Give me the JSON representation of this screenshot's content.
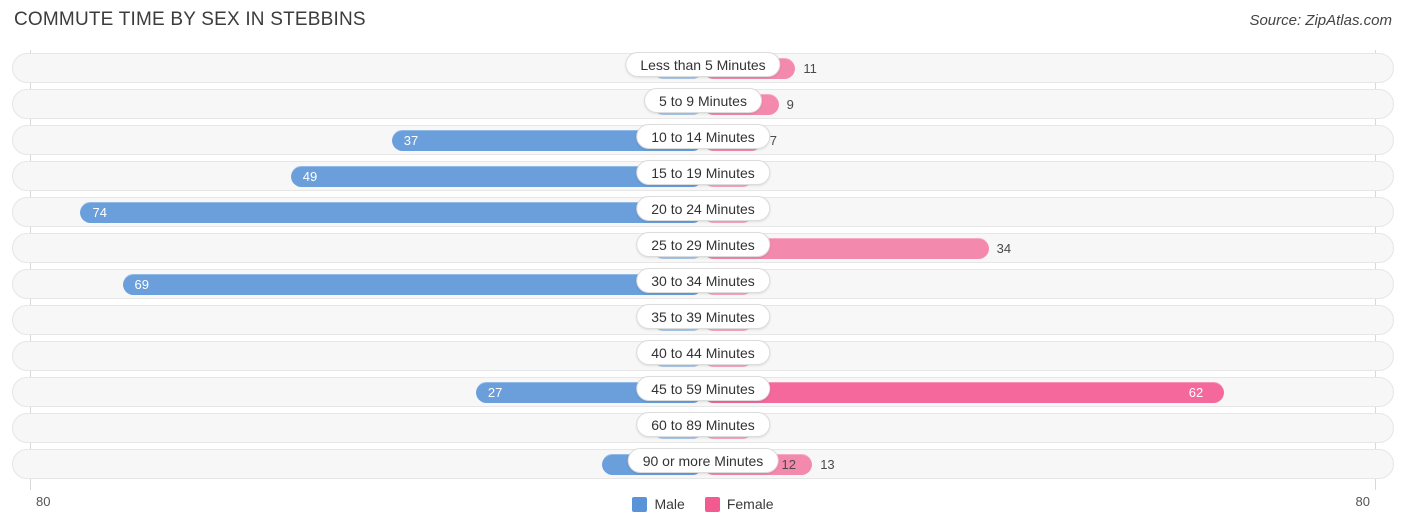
{
  "header": {
    "title": "COMMUTE TIME BY SEX IN STEBBINS",
    "source": "Source: ZipAtlas.com"
  },
  "axis": {
    "left_label": "80",
    "right_label": "80",
    "max": 80
  },
  "legend": {
    "male_label": "Male",
    "female_label": "Female",
    "male_color": "#5b93d8",
    "female_color": "#f25a90"
  },
  "colors": {
    "male": "#6a9fdc",
    "male_light": "#a9c8ea",
    "female": "#f4689c",
    "female_light": "#f9a7c3",
    "female_mid": "#f489ae",
    "track": "#f7f7f7",
    "track_border": "#e6e6e6"
  },
  "chart_data": {
    "type": "bar",
    "title": "COMMUTE TIME BY SEX IN STEBBINS",
    "subtitle": "Source: ZipAtlas.com",
    "orientation": "horizontal-diverging",
    "xlabel": "",
    "ylabel": "",
    "xlim": [
      80,
      80
    ],
    "grid": false,
    "legend_position": "bottom-center",
    "categories": [
      "Less than 5 Minutes",
      "5 to 9 Minutes",
      "10 to 14 Minutes",
      "15 to 19 Minutes",
      "20 to 24 Minutes",
      "25 to 29 Minutes",
      "30 to 34 Minutes",
      "35 to 39 Minutes",
      "40 to 44 Minutes",
      "45 to 59 Minutes",
      "60 to 89 Minutes",
      "90 or more Minutes"
    ],
    "series": [
      {
        "name": "Male",
        "values": [
          0,
          0,
          37,
          49,
          74,
          0,
          69,
          0,
          0,
          27,
          0,
          12
        ]
      },
      {
        "name": "Female",
        "values": [
          11,
          9,
          7,
          0,
          0,
          34,
          0,
          0,
          0,
          62,
          0,
          13
        ]
      }
    ]
  },
  "rows": [
    {
      "label": "Less than 5 Minutes",
      "male": "0",
      "female": "11"
    },
    {
      "label": "5 to 9 Minutes",
      "male": "0",
      "female": "9"
    },
    {
      "label": "10 to 14 Minutes",
      "male": "37",
      "female": "7"
    },
    {
      "label": "15 to 19 Minutes",
      "male": "49",
      "female": "0"
    },
    {
      "label": "20 to 24 Minutes",
      "male": "74",
      "female": "0"
    },
    {
      "label": "25 to 29 Minutes",
      "male": "0",
      "female": "34"
    },
    {
      "label": "30 to 34 Minutes",
      "male": "69",
      "female": "0"
    },
    {
      "label": "35 to 39 Minutes",
      "male": "0",
      "female": "0"
    },
    {
      "label": "40 to 44 Minutes",
      "male": "0",
      "female": "0"
    },
    {
      "label": "45 to 59 Minutes",
      "male": "27",
      "female": "62"
    },
    {
      "label": "60 to 89 Minutes",
      "male": "0",
      "female": "0"
    },
    {
      "label": "90 or more Minutes",
      "male": "12",
      "female": "13"
    }
  ]
}
